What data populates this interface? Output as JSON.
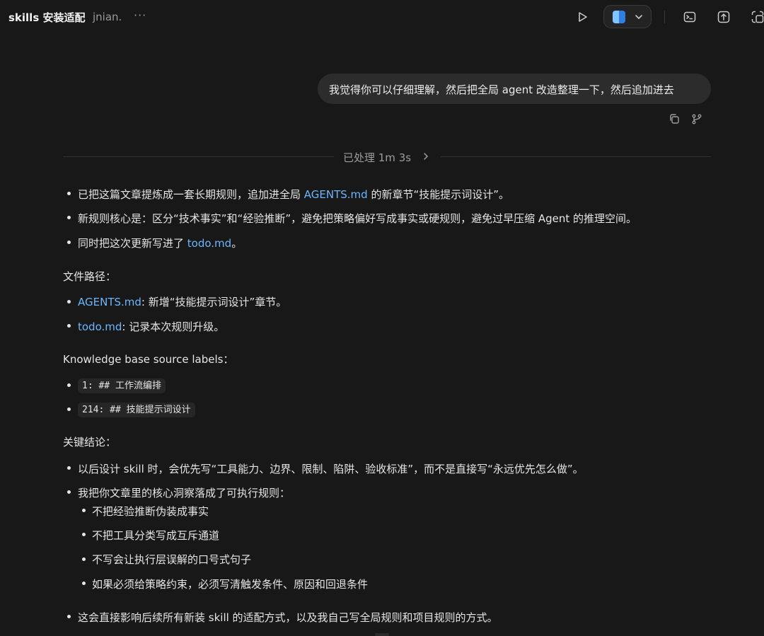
{
  "header": {
    "title": "skills 安装适配",
    "project": "jnian.",
    "more": "···"
  },
  "user_message": "我觉得你可以仔细理解，然后把全局 agent 改造整理一下，然后追加进去",
  "processed": "已处理 1m 3s",
  "summary": {
    "bullets": [
      {
        "pre": "已把这篇文章提炼成一套长期规则，追加进全局 ",
        "link": "AGENTS.md",
        "post": " 的新章节“技能提示词设计”。"
      },
      {
        "pre": "新规则核心是：区分“技术事实”和“经验推断”，避免把策略偏好写成事实或硬规则，避免过早压缩 Agent 的推理空间。",
        "link": "",
        "post": ""
      },
      {
        "pre": "同时把这次更新写进了 ",
        "link": "todo.md",
        "post": "。"
      }
    ]
  },
  "files": {
    "heading": "文件路径：",
    "items": [
      {
        "link": "AGENTS.md",
        "text": ": 新增“技能提示词设计”章节。"
      },
      {
        "link": "todo.md",
        "text": ": 记录本次规则升级。"
      }
    ]
  },
  "kb": {
    "heading": "Knowledge base source labels：",
    "items": [
      "1: ## 工作流编排",
      "214: ## 技能提示词设计"
    ]
  },
  "conclusions": {
    "heading": "关键结论：",
    "b1": "以后设计 skill 时，会优先写“工具能力、边界、限制、陷阱、验收标准”，而不是直接写“永远优先怎么做”。",
    "b2": "我把你文章里的核心洞察落成了可执行规则：",
    "sub": [
      "不把经验推断伪装成事实",
      "不把工具分类写成互斥通道",
      "不写会让执行层误解的口号式句子",
      "如果必须给策略约束，必须写清触发条件、原因和回退条件"
    ],
    "b3": "这会直接影响后续所有新装 skill 的适配方式，以及我自己写全局规则和项目规则的方式。"
  }
}
